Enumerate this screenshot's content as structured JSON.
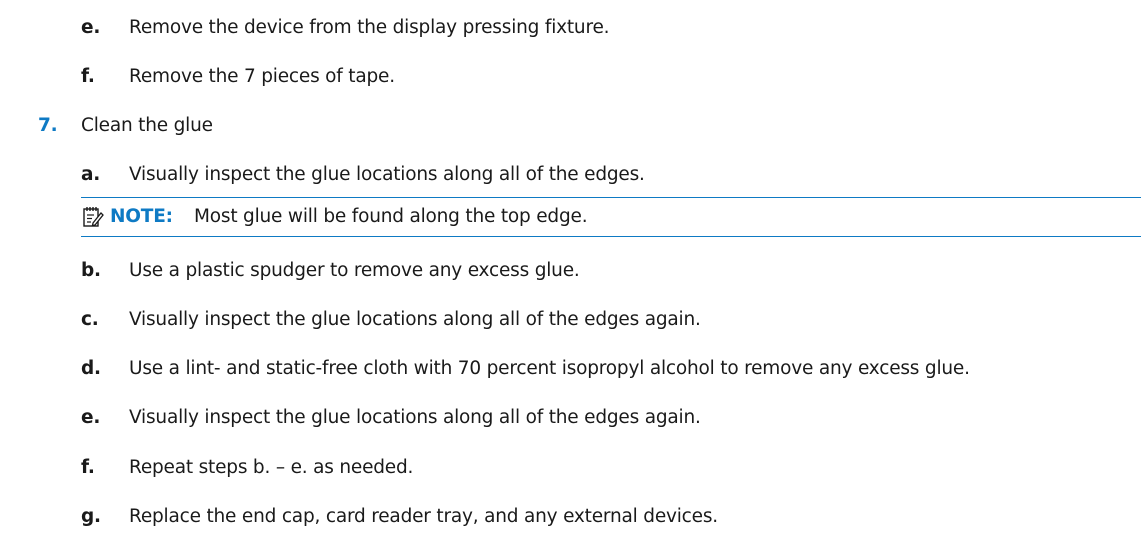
{
  "steps": [
    {
      "marker": "e.",
      "text": "Remove the device from the display pressing fixture."
    },
    {
      "marker": "f.",
      "text": "Remove the 7 pieces of tape."
    },
    {
      "marker": "7.",
      "text": "Clean the glue"
    },
    {
      "marker": "a.",
      "text": "Visually inspect the glue locations along all of the edges."
    },
    {
      "marker": "b.",
      "text": "Use a plastic spudger to remove any excess glue."
    },
    {
      "marker": "c.",
      "text": "Visually inspect the glue locations along all of the edges again."
    },
    {
      "marker": "d.",
      "text": "Use a lint- and static-free cloth with 70 percent isopropyl alcohol to remove any excess glue."
    },
    {
      "marker": "e.",
      "text": "Visually inspect the glue locations along all of the edges again."
    },
    {
      "marker": "f.",
      "text": "Repeat steps b. – e. as needed."
    },
    {
      "marker": "g.",
      "text": "Replace the end cap, card reader tray, and any external devices."
    }
  ],
  "note": {
    "icon": "note-icon",
    "label": "NOTE:",
    "text": "Most glue will be found along the top edge."
  },
  "colors": {
    "accent": "#0e7ac4",
    "text": "#1a1a1a"
  }
}
